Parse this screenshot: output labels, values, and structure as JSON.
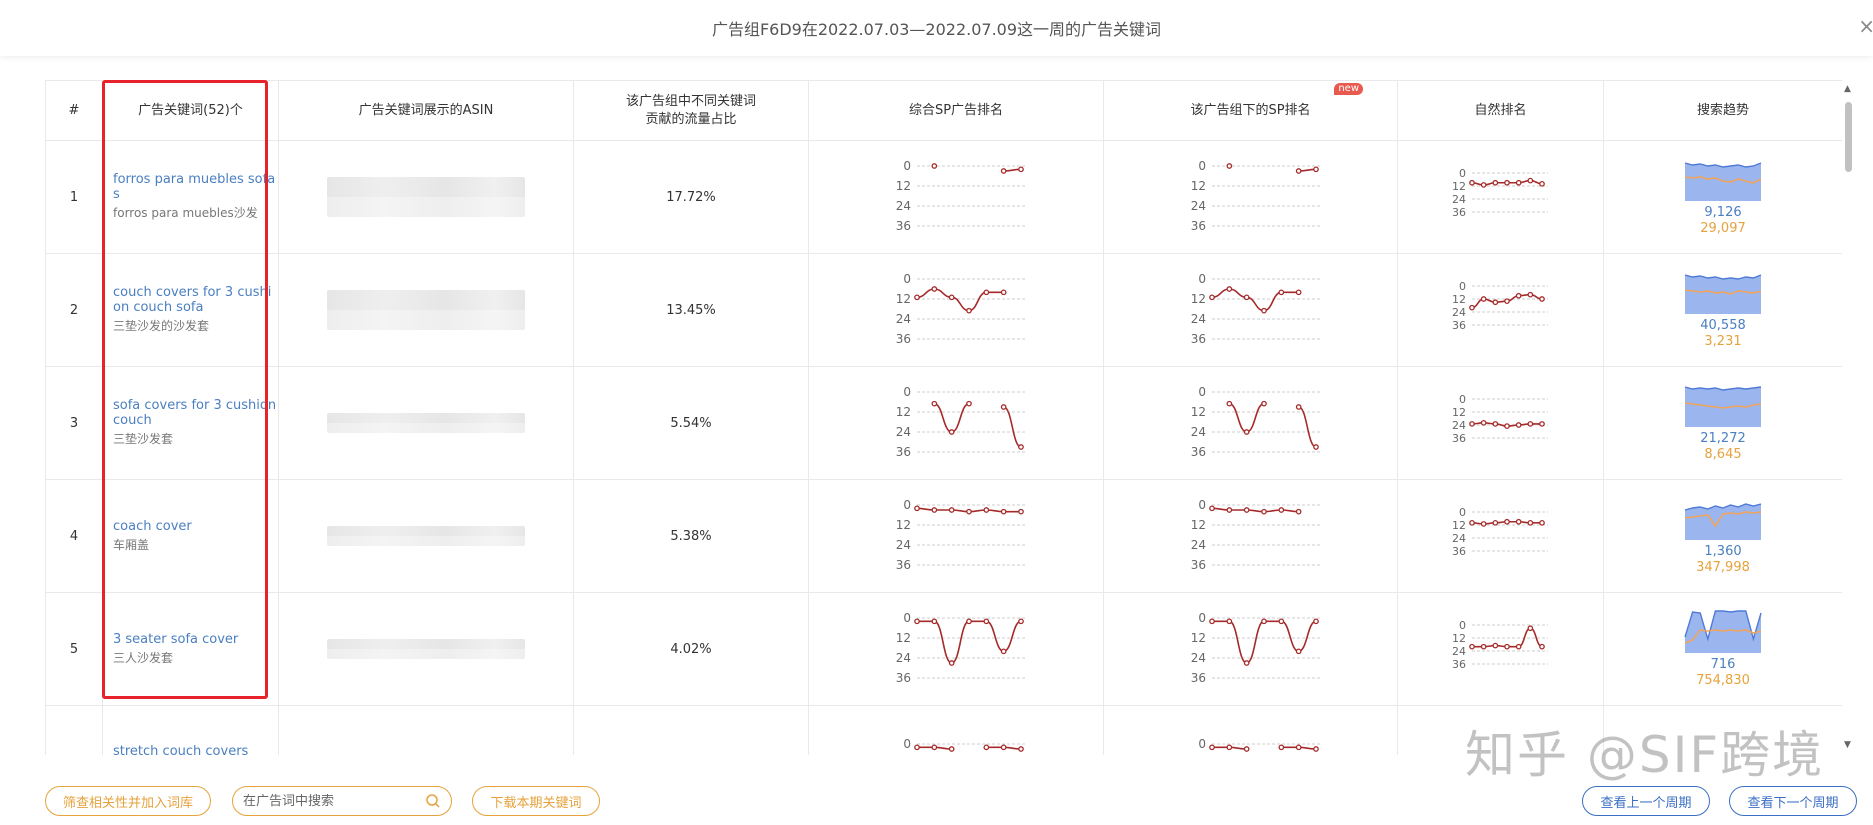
{
  "header": {
    "title": "广告组F6D9在2022.07.03—2022.07.09这一周的广告关键词",
    "close_label": "×"
  },
  "columns": {
    "index": "#",
    "keyword": "广告关键词(52)个",
    "asin": "广告关键词展示的ASIN",
    "share_line1": "该广告组中不同关键词",
    "share_line2": "贡献的流量占比",
    "sp_rank": "综合SP广告排名",
    "group_sp_rank": "该广告组下的SP排名",
    "new_badge": "new",
    "organic_rank": "自然排名",
    "trend": "搜索趋势"
  },
  "rank_axis_ticks": [
    "0",
    "12",
    "24",
    "36"
  ],
  "colors": {
    "rank_line": "#a52a2a",
    "trend_area": "#7a9ee8",
    "trend_line": "#f0a35a",
    "link": "#4a7fc1",
    "highlight_frame": "#e8222a"
  },
  "rows": [
    {
      "index": "1",
      "keyword_en": "forros para muebles sofas",
      "keyword_cn": "forros para muebles沙发",
      "share": "17.72%",
      "sp_rank": [
        null,
        0,
        null,
        null,
        null,
        3,
        2
      ],
      "group_sp_rank": [
        null,
        0,
        null,
        null,
        null,
        3,
        2
      ],
      "organic_rank": [
        9,
        11,
        9,
        9,
        9,
        7,
        10
      ],
      "trend_top": "9,126",
      "trend_bottom": "29,097"
    },
    {
      "index": "2",
      "keyword_en": "couch covers for 3 cushion couch sofa",
      "keyword_cn": "三垫沙发的沙发套",
      "share": "13.45%",
      "sp_rank": [
        11,
        6,
        11,
        19,
        8,
        8,
        null
      ],
      "group_sp_rank": [
        11,
        6,
        11,
        19,
        8,
        8,
        null
      ],
      "organic_rank": [
        20,
        12,
        15,
        14,
        9,
        8,
        12
      ],
      "trend_top": "40,558",
      "trend_bottom": "3,231"
    },
    {
      "index": "3",
      "keyword_en": "sofa covers for 3 cushion couch",
      "keyword_cn": "三垫沙发套",
      "share": "5.54%",
      "sp_rank": [
        null,
        7,
        24,
        7,
        null,
        9,
        33
      ],
      "group_sp_rank": [
        null,
        7,
        24,
        7,
        null,
        9,
        33
      ],
      "organic_rank": [
        23,
        22,
        23,
        25,
        24,
        23,
        23
      ],
      "trend_top": "21,272",
      "trend_bottom": "8,645"
    },
    {
      "index": "4",
      "keyword_en": "coach cover",
      "keyword_cn": "车厢盖",
      "share": "5.38%",
      "sp_rank": [
        2,
        3,
        3,
        4,
        3,
        4,
        4
      ],
      "group_sp_rank": [
        2,
        3,
        3,
        4,
        3,
        4,
        null
      ],
      "organic_rank": [
        10,
        11,
        10,
        9,
        9,
        10,
        10
      ],
      "trend_top": "1,360",
      "trend_bottom": "347,998"
    },
    {
      "index": "5",
      "keyword_en": "3 seater sofa cover",
      "keyword_cn": "三人沙发套",
      "share": "4.02%",
      "sp_rank": [
        2,
        2,
        27,
        2,
        2,
        20,
        2
      ],
      "group_sp_rank": [
        2,
        2,
        27,
        2,
        2,
        20,
        2
      ],
      "organic_rank": [
        20,
        20,
        19,
        20,
        20,
        3,
        20
      ],
      "trend_top": "716",
      "trend_bottom": "754,830"
    },
    {
      "index": "",
      "keyword_en": "stretch couch covers",
      "keyword_cn": "",
      "share": "",
      "sp_rank": [
        2,
        2,
        3,
        null,
        2,
        2,
        3
      ],
      "group_sp_rank": [
        2,
        2,
        3,
        null,
        2,
        2,
        3
      ],
      "organic_rank": [],
      "trend_top": "",
      "trend_bottom": ""
    }
  ],
  "footer": {
    "filter_button": "筛查相关性并加入词库",
    "search_placeholder": "在广告词中搜索",
    "download_button": "下载本期关键词",
    "prev_period": "查看上一个周期",
    "next_period": "查看下一个周期"
  },
  "watermark": "知乎 @SIF跨境"
}
